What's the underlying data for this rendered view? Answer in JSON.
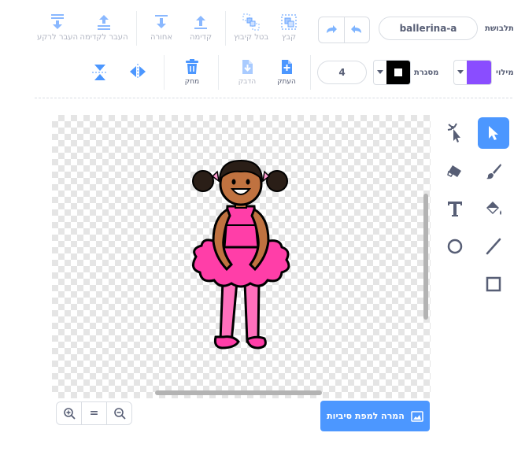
{
  "costume": {
    "label": "תלבושת",
    "name": "ballerina-a"
  },
  "toolbar_top": {
    "group": "קבץ",
    "ungroup": "בטל קיבוץ",
    "forward": "קדימה",
    "backward": "אחורה",
    "front": "העבר לקדימה",
    "back": "העבר לרקע"
  },
  "toolbar_second": {
    "fill_label": "מילוי",
    "fill_color": "#8a4dff",
    "outline_label": "מסגרת",
    "outline_color": "#000000",
    "outline_width": "4",
    "copy": "העתק",
    "paste": "הדבק",
    "delete": "מחק"
  },
  "colors": {
    "accent": "#4c97ff",
    "text": "#575e75",
    "delete": "#4c97ff"
  },
  "convert_button": "המרה למפת סיביות",
  "zoom": {
    "equal": "="
  }
}
